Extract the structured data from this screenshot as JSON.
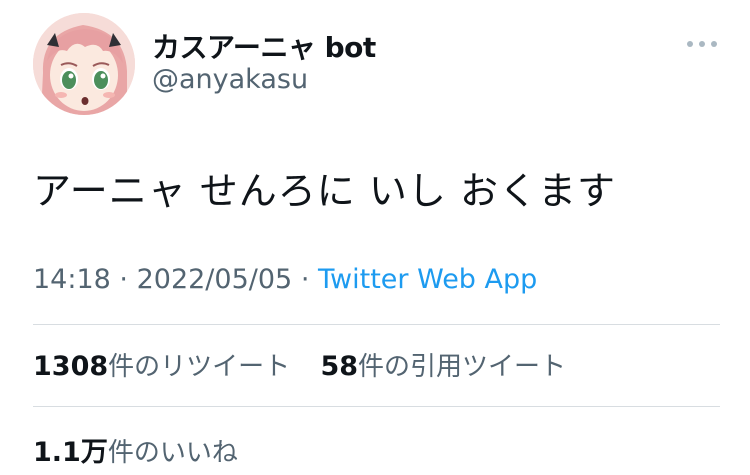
{
  "user": {
    "display_name": "カスアーニャ bot",
    "handle": "@anyakasu",
    "avatar_icon": "anime-girl-avatar-icon"
  },
  "tweet": {
    "text": "アーニャ せんろに いし おくます",
    "time": "14:18",
    "separator": "·",
    "date": "2022/05/05",
    "source": "Twitter Web App"
  },
  "stats": {
    "retweets": {
      "count": "1308",
      "label": "件のリツイート"
    },
    "quotes": {
      "count": "58",
      "label": "件の引用ツイート"
    },
    "likes": {
      "count": "1.1万",
      "label": "件のいいね"
    }
  },
  "colors": {
    "text": "#0f1419",
    "muted": "#536471",
    "link": "#1d9bf0",
    "divider": "#d8dde1"
  }
}
